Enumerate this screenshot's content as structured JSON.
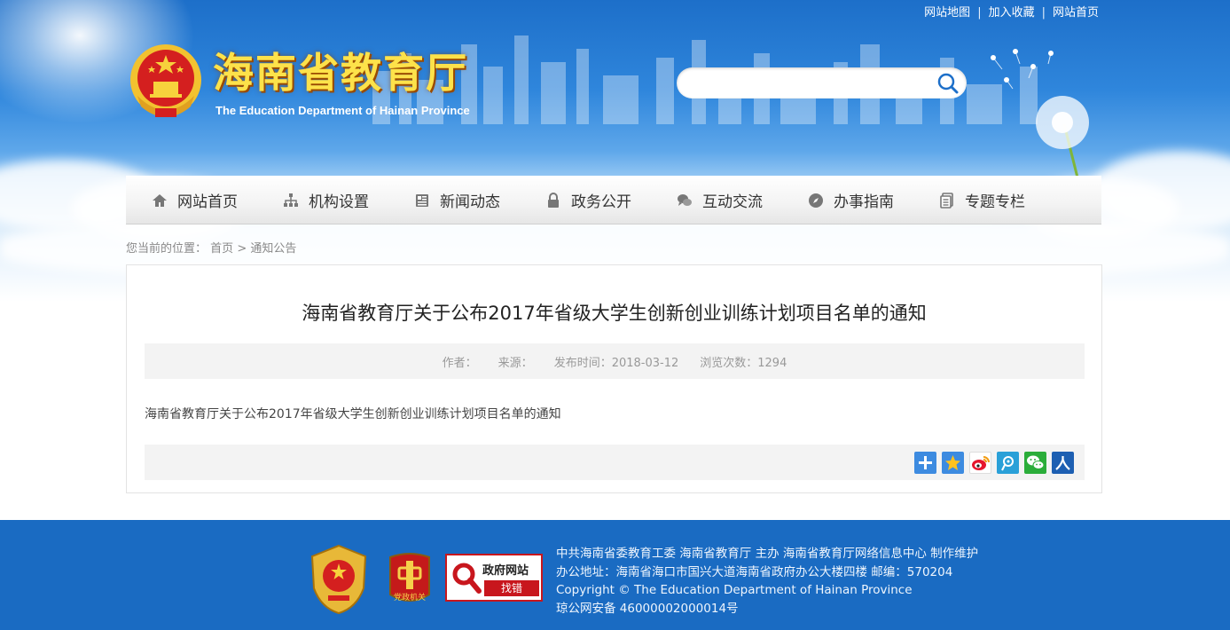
{
  "top_links": [
    "网站地图",
    "加入收藏",
    "网站首页"
  ],
  "header": {
    "title": "海南省教育厅",
    "subtitle": "The Education Department of Hainan Province"
  },
  "search": {
    "placeholder": "",
    "value": ""
  },
  "nav": {
    "items": [
      {
        "label": "网站首页",
        "icon": "home-icon"
      },
      {
        "label": "机构设置",
        "icon": "org-chart-icon"
      },
      {
        "label": "新闻动态",
        "icon": "news-icon"
      },
      {
        "label": "政务公开",
        "icon": "lock-icon"
      },
      {
        "label": "互动交流",
        "icon": "chat-icon"
      },
      {
        "label": "办事指南",
        "icon": "compass-icon"
      },
      {
        "label": "专题专栏",
        "icon": "document-icon"
      }
    ]
  },
  "breadcrumb": {
    "prefix": "您当前的位置：",
    "home": "首页",
    "sep": ">",
    "current": "通知公告"
  },
  "article": {
    "title": "海南省教育厅关于公布2017年省级大学生创新创业训练计划项目名单的通知",
    "author": "作者：",
    "source": "来源：",
    "publish_time": "发布时间：2018-03-12",
    "views": "浏览次数：1294",
    "body": "海南省教育厅关于公布2017年省级大学生创新创业训练计划项目名单的通知"
  },
  "share": [
    "share-more-icon",
    "qzone-icon",
    "weibo-icon",
    "tencent-weibo-icon",
    "wechat-icon",
    "renren-icon"
  ],
  "footer": {
    "badge_top": "政府网站",
    "badge_bottom": "找错",
    "party_label": "党政机关",
    "lines": [
      "中共海南省委教育工委    海南省教育厅 主办 海南省教育厅网络信息中心 制作维护",
      "办公地址：海南省海口市国兴大道海南省政府办公大楼四楼      邮编：570204",
      "Copyright © The Education Department of Hainan Province",
      "琼公网安备 46000002000014号"
    ]
  },
  "colors": {
    "header_blue": "#2f86dc",
    "footer_blue": "#1a6bc2",
    "title_gold": "#fde24a",
    "badge_red": "#c8161d"
  }
}
